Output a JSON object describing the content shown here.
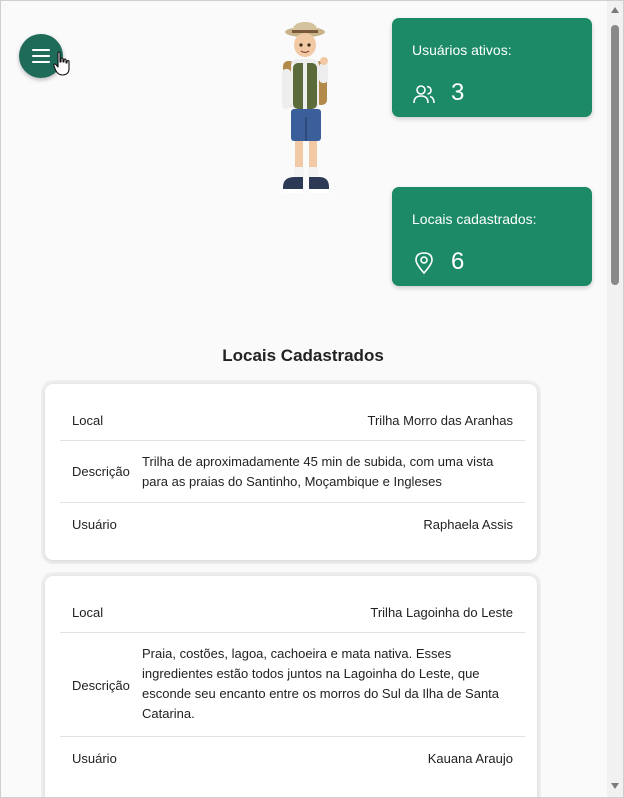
{
  "menu": {
    "icon": "hamburger-menu-icon"
  },
  "stats": [
    {
      "label": "Usuários ativos:",
      "value": "3",
      "icon": "users-icon"
    },
    {
      "label": "Locais cadastrados:",
      "value": "6",
      "icon": "map-pin-icon"
    }
  ],
  "section_title": "Locais Cadastrados",
  "labels": {
    "local": "Local",
    "descricao": "Descrição",
    "usuario": "Usuário"
  },
  "locations": [
    {
      "local": "Trilha Morro das Aranhas",
      "descricao": "Trilha de aproximadamente 45 min de subida, com uma vista para as praias do Santinho, Moçambique e Ingleses",
      "usuario": "Raphaela Assis"
    },
    {
      "local": "Trilha Lagoinha do Leste",
      "descricao": "Praia, costões, lagoa, cachoeira e mata nativa. Esses ingredientes estão todos juntos na Lagoinha do Leste, que esconde seu encanto entre os morros do Sul da Ilha de Santa Catarina.",
      "usuario": "Kauana Araujo"
    }
  ],
  "colors": {
    "accent": "#1c8a67",
    "menu": "#1f6b5a"
  }
}
